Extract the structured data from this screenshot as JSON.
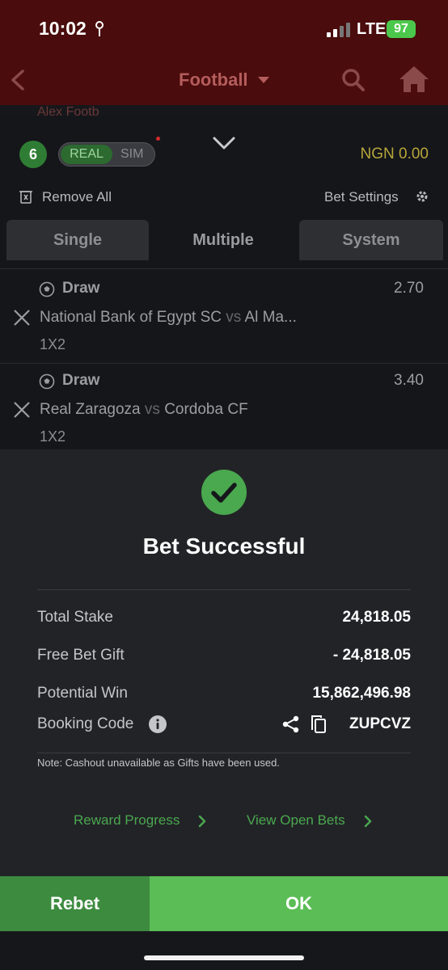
{
  "status_bar": {
    "time": "10:02",
    "network": "LTE",
    "battery": "97"
  },
  "header": {
    "title": "Football"
  },
  "background_text": "Alex Footb",
  "slip": {
    "count": "6",
    "toggle_real": "REAL",
    "toggle_sim": "SIM",
    "balance": "NGN 0.00",
    "remove_all": "Remove All",
    "bet_settings": "Bet Settings",
    "tabs": [
      {
        "label": "Single"
      },
      {
        "label": "Multiple"
      },
      {
        "label": "System"
      }
    ],
    "selections": [
      {
        "pick": "Draw",
        "odds": "2.70",
        "home": "National Bank of Egypt SC",
        "vs": "vs",
        "away": "Al Ma...",
        "market": "1X2"
      },
      {
        "pick": "Draw",
        "odds": "3.40",
        "home": "Real Zaragoza",
        "vs": "vs",
        "away": "Cordoba CF",
        "market": "1X2"
      }
    ]
  },
  "success": {
    "title": "Bet Successful",
    "rows": [
      {
        "label": "Total Stake",
        "value": "24,818.05"
      },
      {
        "label": "Free Bet Gift",
        "value": "- 24,818.05"
      },
      {
        "label": "Potential Win",
        "value": "15,862,496.98"
      },
      {
        "label": "Booking Code",
        "value": "ZUPCVZ"
      }
    ],
    "note": "Note: Cashout unavailable as Gifts have been used.",
    "reward_progress": "Reward Progress",
    "view_open_bets": "View Open Bets"
  },
  "buttons": {
    "rebet": "Rebet",
    "ok": "OK"
  },
  "colors": {
    "accent_green": "#5bbd55",
    "dark_green": "#3d8b3f",
    "header_red": "#4a0c0c",
    "balance_gold": "#b6a63a",
    "panel": "#222327"
  }
}
